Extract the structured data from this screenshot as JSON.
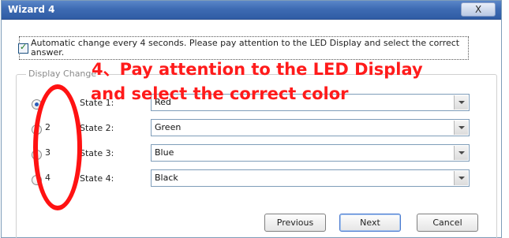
{
  "window": {
    "title": "Wizard 4",
    "close_glyph": "X"
  },
  "auto_change": {
    "checked": true,
    "text": "Automatic change every 4 seconds. Please pay attention to the LED Display and select the correct answer."
  },
  "display_change": {
    "label": "Display Change"
  },
  "states": [
    {
      "radio_number": "",
      "label": "State 1:",
      "value": "Red",
      "selected": true
    },
    {
      "radio_number": "2",
      "label": "State 2:",
      "value": "Green",
      "selected": false
    },
    {
      "radio_number": "3",
      "label": "State 3:",
      "value": "Blue",
      "selected": false
    },
    {
      "radio_number": "4",
      "label": "State 4:",
      "value": "Black",
      "selected": false
    }
  ],
  "buttons": {
    "previous": "Previous",
    "next": "Next",
    "cancel": "Cancel"
  },
  "annotation": {
    "line1": "4、Pay attention to the LED Display",
    "line2": "and select the correct color"
  },
  "colors": {
    "annotation_red": "#ff1b1b",
    "title_blue": "#3e6bb3"
  },
  "icons": {
    "checkbox": "check-icon",
    "close": "close-icon",
    "dropdown": "chevron-down-icon"
  }
}
